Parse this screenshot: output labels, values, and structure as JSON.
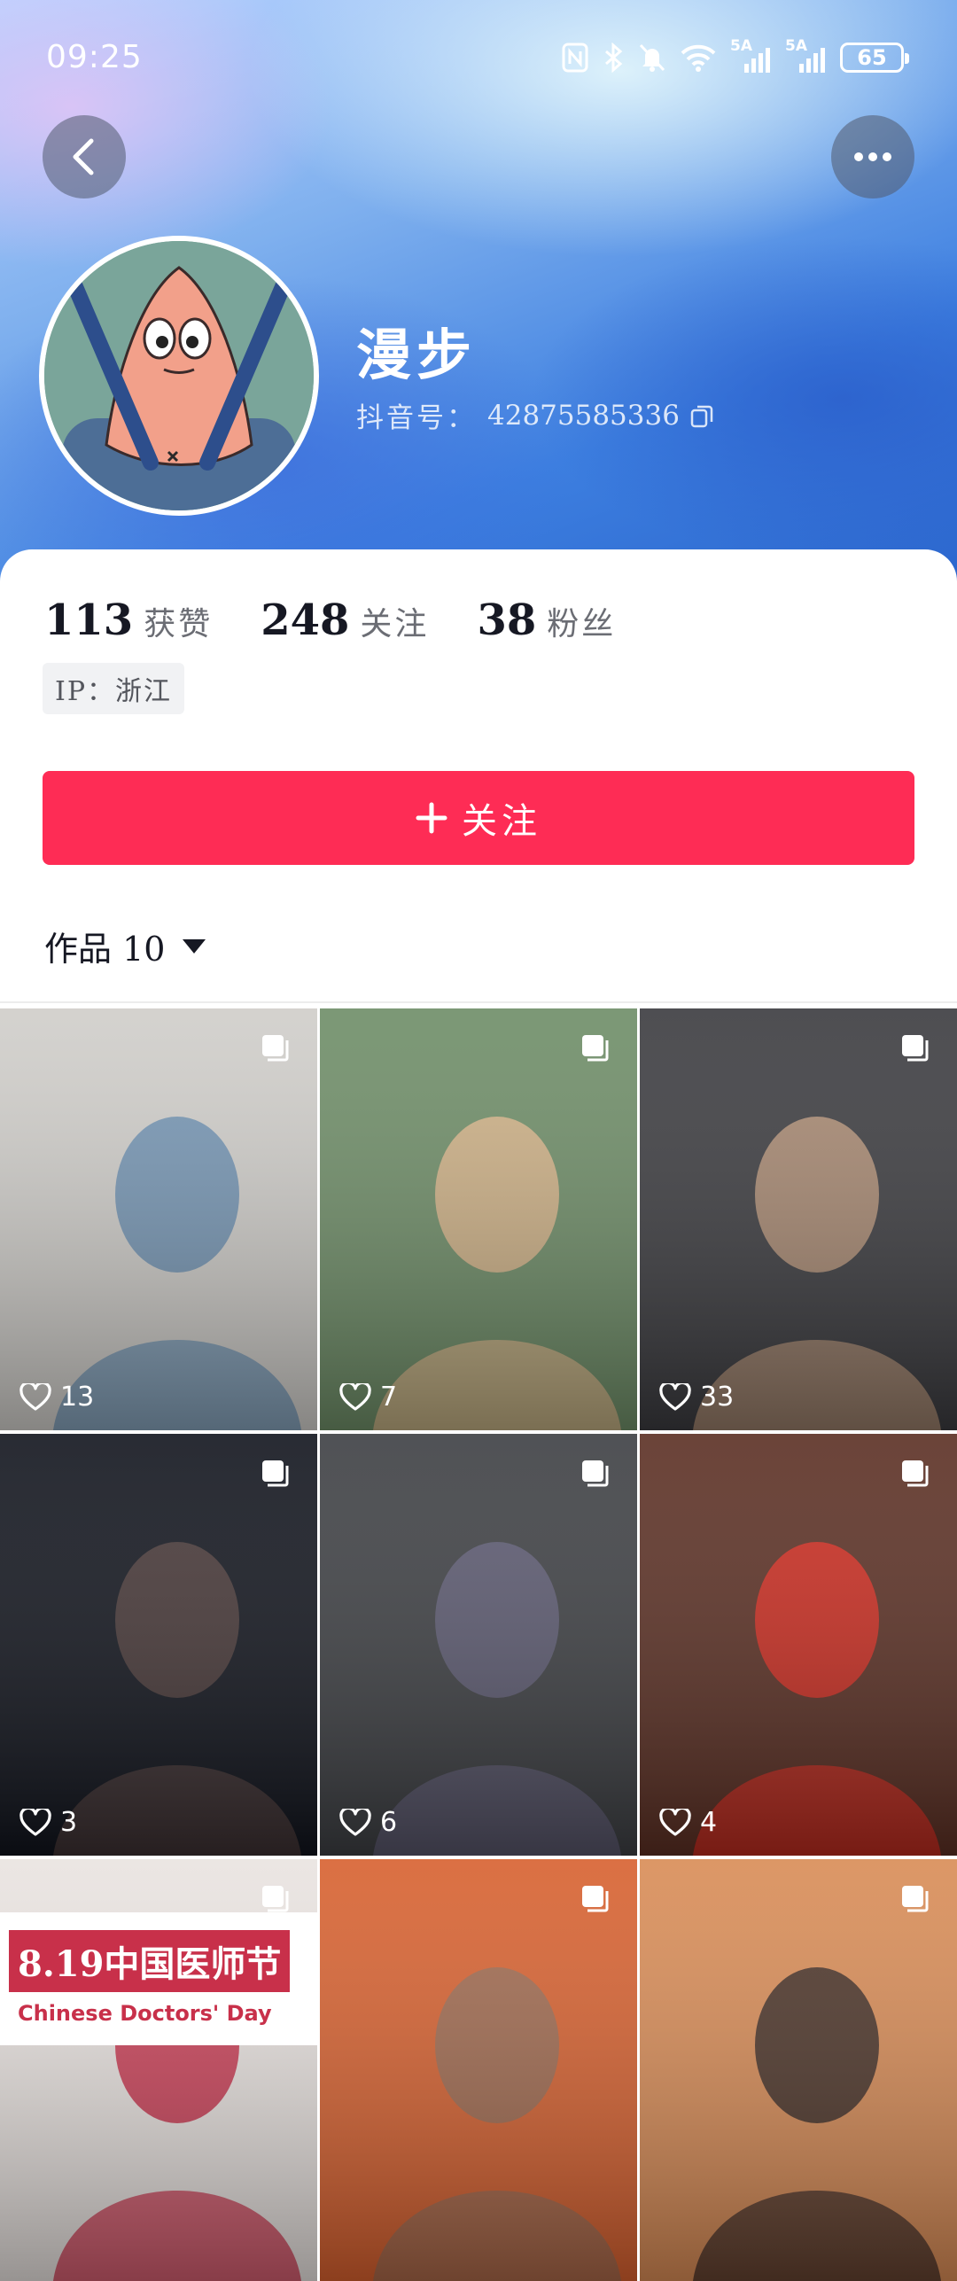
{
  "status_bar": {
    "time": "09:25",
    "signal_1": "5A",
    "signal_2": "5A",
    "battery": "65"
  },
  "profile": {
    "nickname": "漫步",
    "douyin_id_label": "抖音号：",
    "douyin_id": "42875585336",
    "stats": [
      {
        "num": "113",
        "label": "获赞"
      },
      {
        "num": "248",
        "label": "关注"
      },
      {
        "num": "38",
        "label": "粉丝"
      }
    ],
    "ip": "IP：浙江",
    "follow_label": "关注",
    "works_label": "作品 10"
  },
  "colors": {
    "accent": "#fe2c55",
    "text": "#161823"
  },
  "works": [
    {
      "likes": "13",
      "bg": "#cfcdc9",
      "accent": "#6a8fb0"
    },
    {
      "likes": "7",
      "bg": "#6d8c66",
      "accent": "#d7b488"
    },
    {
      "likes": "33",
      "bg": "#3a3a3e",
      "accent": "#b39076"
    },
    {
      "likes": "3",
      "bg": "#10131c",
      "accent": "#4a3a38"
    },
    {
      "likes": "6",
      "bg": "#3c3e42",
      "accent": "#5d5b74"
    },
    {
      "likes": "4",
      "bg": "#5a2e22",
      "accent": "#d62a1e"
    },
    {
      "likes": "",
      "bg": "#e9e3e0",
      "accent": "#c8304a",
      "banner": "8.19中国医师节",
      "banner_sub": "Chinese Doctors' Day"
    },
    {
      "likes": "",
      "bg": "#d7602e",
      "accent": "#9a6a52"
    },
    {
      "likes": "",
      "bg": "#d88b55",
      "accent": "#3d2a24"
    }
  ]
}
